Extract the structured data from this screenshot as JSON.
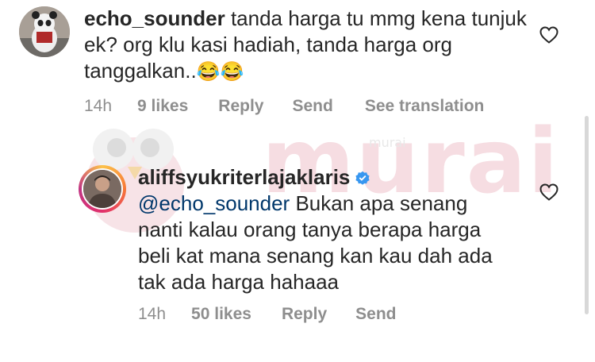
{
  "watermark": {
    "brand": "murai",
    "small": "murai"
  },
  "comments": [
    {
      "username": "echo_sounder",
      "text": "tanda harga tu mmg kena tunjuk ek? org klu kasi hadiah, tanda harga org tanggalkan..",
      "emoji": "😂😂",
      "time": "14h",
      "likes": "9 likes",
      "reply": "Reply",
      "send": "Send",
      "translate": "See translation"
    },
    {
      "username": "aliffsyukriterlajaklaris",
      "mention": "@echo_sounder",
      "text": "Bukan apa senang nanti kalau orang tanya berapa harga beli kat mana senang kan kau dah ada tak ada harga hahaaa",
      "time": "14h",
      "likes": "50 likes",
      "reply": "Reply",
      "send": "Send"
    }
  ],
  "colors": {
    "mention": "#00376b",
    "meta": "#8e8e8e",
    "verified": "#3897f0"
  }
}
